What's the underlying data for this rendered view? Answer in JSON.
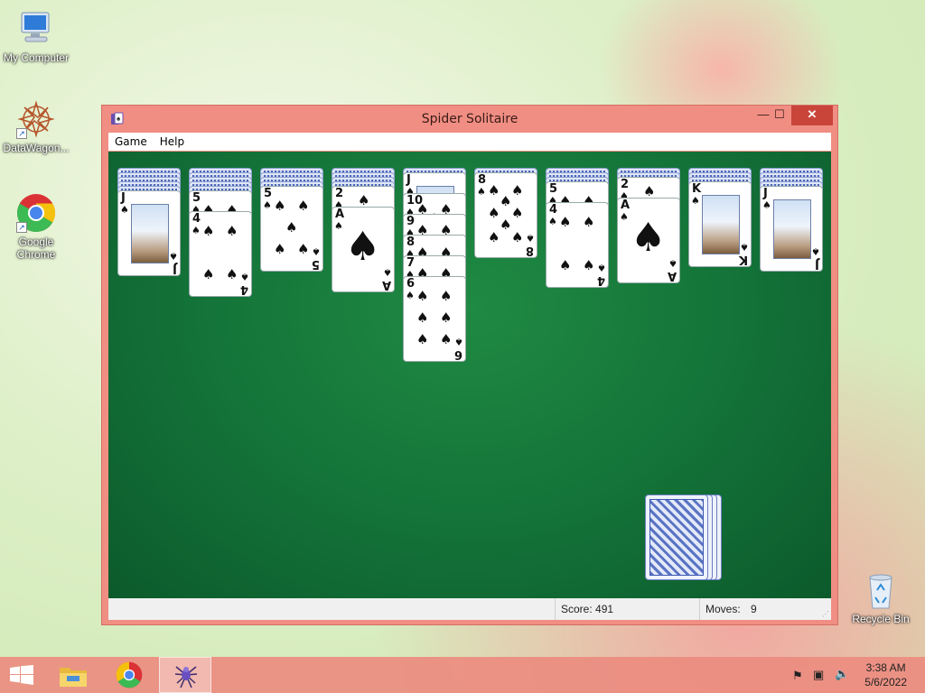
{
  "desktop": {
    "icons": [
      {
        "label": "My Computer"
      },
      {
        "label": "DataWagon..."
      },
      {
        "label": "Google Chrome"
      },
      {
        "label": "Recycle Bin"
      }
    ]
  },
  "window": {
    "title": "Spider Solitaire",
    "controls": {
      "minimize": "—",
      "maximize": "☐",
      "close": "✕"
    },
    "menu": {
      "game": "Game",
      "help": "Help"
    },
    "status": {
      "score": "Score: 491",
      "moves_label": "Moves:",
      "moves_value": "9"
    }
  },
  "game": {
    "suit_symbol": "♠",
    "columns": [
      {
        "hidden": 5,
        "cards": [
          "J"
        ]
      },
      {
        "hidden": 5,
        "cards": [
          "5",
          "4"
        ]
      },
      {
        "hidden": 4,
        "cards": [
          "5"
        ]
      },
      {
        "hidden": 4,
        "cards": [
          "2",
          "A"
        ]
      },
      {
        "hidden": 1,
        "cards": [
          "J",
          "10",
          "9",
          "8",
          "7",
          "6"
        ]
      },
      {
        "hidden": 1,
        "cards": [
          "8"
        ]
      },
      {
        "hidden": 3,
        "cards": [
          "5",
          "4"
        ]
      },
      {
        "hidden": 2,
        "cards": [
          "2",
          "A"
        ]
      },
      {
        "hidden": 3,
        "cards": [
          "K"
        ]
      },
      {
        "hidden": 4,
        "cards": [
          "J"
        ]
      }
    ],
    "stock_piles": 4
  },
  "taskbar": {
    "items": [
      {
        "icon": "windows-start-icon"
      },
      {
        "icon": "file-explorer-icon"
      },
      {
        "icon": "chrome-icon"
      },
      {
        "icon": "spider-solitaire-icon"
      }
    ],
    "clock_time": "3:38 AM",
    "clock_date": "5/6/2022"
  },
  "colors": {
    "window_frame": "#f08e83",
    "felt": "#137238",
    "taskbar": "#ec8c80"
  }
}
